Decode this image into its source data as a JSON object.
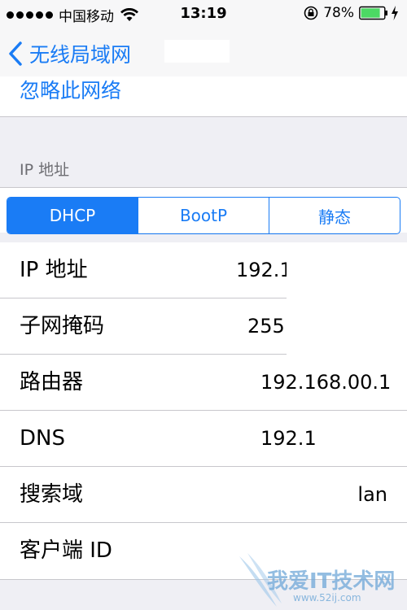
{
  "status_bar": {
    "carrier": "中国移动",
    "time": "13:19",
    "battery": "78%",
    "icons": [
      "signal-dots-icon",
      "wifi-icon",
      "rotation-lock-icon",
      "battery-icon",
      "charging-icon"
    ]
  },
  "nav": {
    "back_label": "无线局域网"
  },
  "forget_network": "忽略此网络",
  "section_header": "IP 地址",
  "segments": [
    {
      "label": "DHCP",
      "selected": true
    },
    {
      "label": "BootP",
      "selected": false
    },
    {
      "label": "静态",
      "selected": false
    }
  ],
  "rows": [
    {
      "label": "IP 地址",
      "value": "192.1"
    },
    {
      "label": "子网掩码",
      "value": "255"
    },
    {
      "label": "路由器",
      "value": "192.168.00.1"
    },
    {
      "label": "DNS",
      "value": "192.1"
    },
    {
      "label": "搜索域",
      "value": "lan"
    },
    {
      "label": "客户端 ID",
      "value": ""
    }
  ],
  "watermark": {
    "text": "我爱IT技术网",
    "url": "www.52ij.com"
  },
  "colors": {
    "accent": "#1a7cf5",
    "background": "#efeff4",
    "battery": "#4cd964"
  }
}
